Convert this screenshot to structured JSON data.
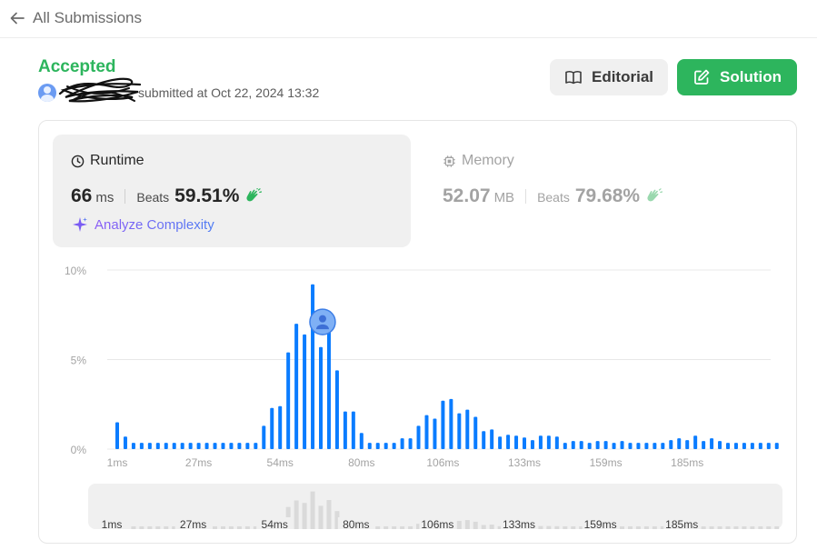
{
  "nav": {
    "back_label": "All Submissions",
    "back_icon": "arrow-left-icon"
  },
  "submission": {
    "status": "Accepted",
    "status_color": "#2db55d",
    "submitted_text": "submitted at Oct 22, 2024 13:32"
  },
  "buttons": {
    "editorial": "Editorial",
    "solution": "Solution",
    "solution_color": "#2db55d"
  },
  "runtime": {
    "label": "Runtime",
    "value": "66",
    "unit": "ms",
    "beats_label": "Beats",
    "beats_value": "59.51%",
    "analyze_label": "Analyze Complexity"
  },
  "memory": {
    "label": "Memory",
    "value": "52.07",
    "unit": "MB",
    "beats_label": "Beats",
    "beats_value": "79.68%"
  },
  "chart_data": {
    "type": "bar",
    "x_tick_labels": [
      "1ms",
      "27ms",
      "54ms",
      "80ms",
      "106ms",
      "133ms",
      "159ms",
      "185ms"
    ],
    "y_tick_labels": [
      "0%",
      "5%",
      "10%"
    ],
    "ylim": [
      0,
      10
    ],
    "grid": true,
    "bar_color": "#0a7cff",
    "highlight_bar_index": 26,
    "values": [
      1.5,
      0.7,
      0.35,
      0.35,
      0.35,
      0.35,
      0.35,
      0.35,
      0.35,
      0.35,
      0.35,
      0.35,
      0.35,
      0.35,
      0.35,
      0.35,
      0.35,
      0.35,
      1.3,
      2.3,
      2.4,
      5.4,
      7.0,
      6.4,
      9.2,
      5.7,
      7.1,
      4.4,
      2.1,
      2.1,
      0.9,
      0.35,
      0.35,
      0.35,
      0.35,
      0.6,
      0.6,
      1.3,
      1.9,
      1.7,
      2.7,
      2.8,
      2.0,
      2.2,
      1.8,
      1.0,
      1.1,
      0.7,
      0.8,
      0.75,
      0.65,
      0.5,
      0.75,
      0.75,
      0.7,
      0.35,
      0.45,
      0.45,
      0.35,
      0.45,
      0.45,
      0.35,
      0.45,
      0.35,
      0.35,
      0.35,
      0.35,
      0.35,
      0.5,
      0.6,
      0.5,
      0.75,
      0.45,
      0.6,
      0.45,
      0.35,
      0.35,
      0.35,
      0.35,
      0.35,
      0.35,
      0.35,
      0.35,
      0.35
    ]
  }
}
